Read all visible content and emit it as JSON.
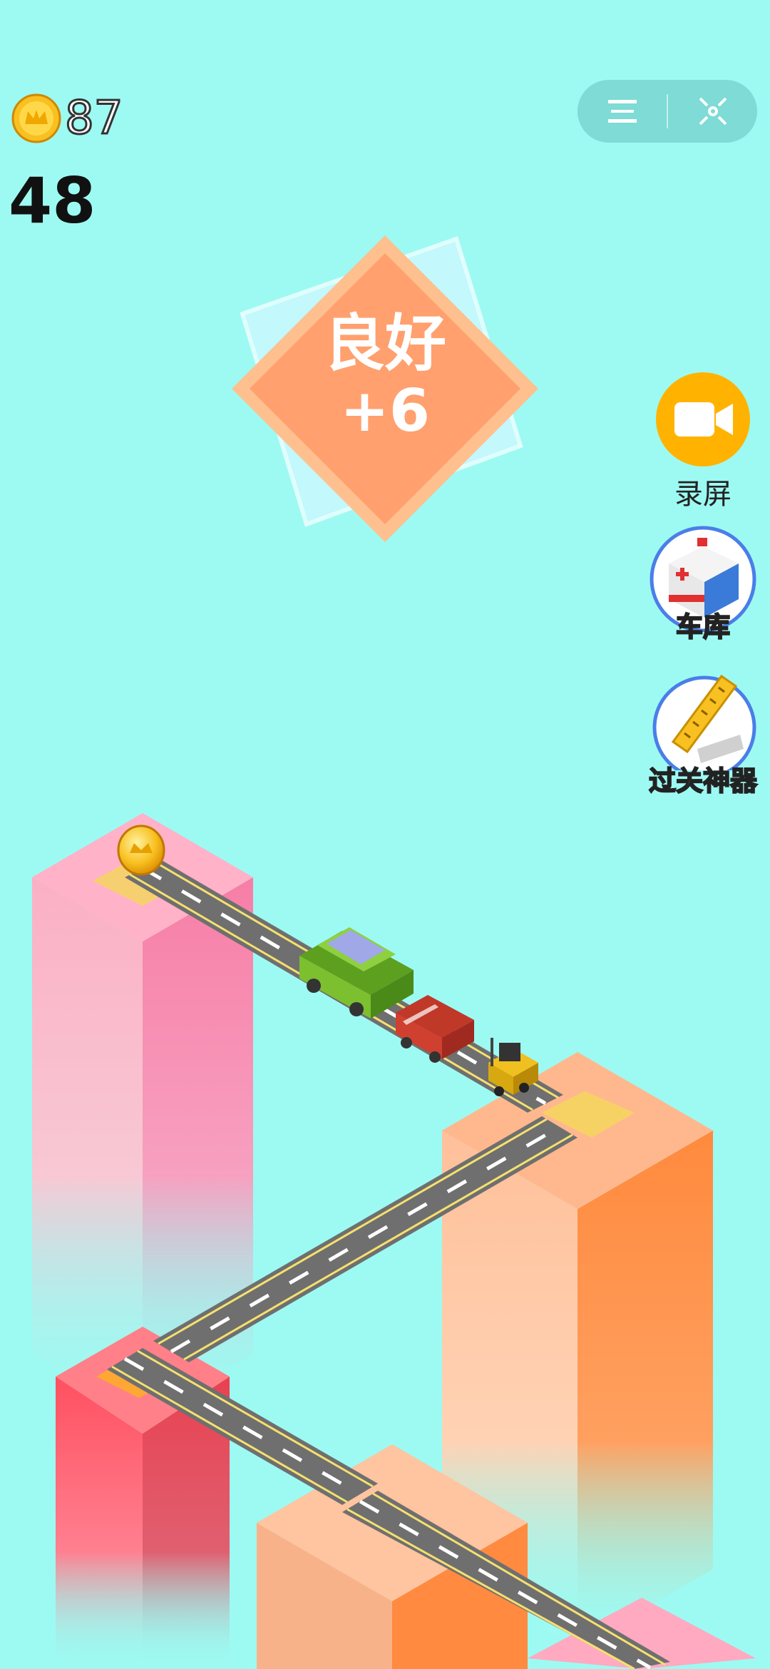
{
  "hud": {
    "coins": "87",
    "score": "48"
  },
  "capsule": {
    "menu_icon": "menu-lines-icon",
    "close_icon": "target-close-icon"
  },
  "rating": {
    "title": "良好",
    "bonus": "+6"
  },
  "side_buttons": [
    {
      "label": "录屏",
      "icon": "video-camera-icon",
      "color": "#ffb300"
    },
    {
      "label": "车库",
      "icon": "ambulance-icon"
    },
    {
      "label": "过关神器",
      "icon": "ruler-icon"
    }
  ],
  "colors": {
    "background": "#9dfaf2",
    "pillar_pink": "#f07aa0",
    "pillar_orange": "#ff8a40",
    "pillar_red": "#ff4a4a",
    "road": "#6f6f6f",
    "road_line": "#f4e070",
    "rating_diamond": "#ffa06e"
  }
}
